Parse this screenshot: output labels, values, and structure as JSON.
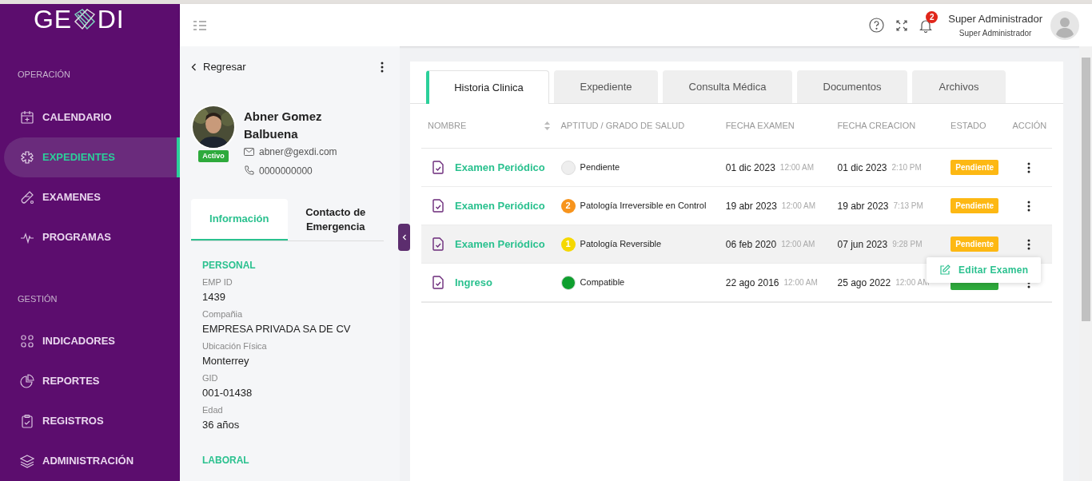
{
  "logo": {
    "left": "GE",
    "right": "DI"
  },
  "sidebar": {
    "sections": [
      {
        "title": "OPERACIÓN",
        "items": [
          {
            "label": "CALENDARIO",
            "selected": false
          },
          {
            "label": "EXPEDIENTES",
            "selected": true
          },
          {
            "label": "EXAMENES",
            "selected": false
          },
          {
            "label": "PROGRAMAS",
            "selected": false
          }
        ]
      },
      {
        "title": "GESTIÓN",
        "items": [
          {
            "label": "INDICADORES",
            "selected": false
          },
          {
            "label": "REPORTES",
            "selected": false
          },
          {
            "label": "REGISTROS",
            "selected": false
          },
          {
            "label": "ADMINISTRACIÓN",
            "selected": false
          }
        ]
      }
    ]
  },
  "topbar": {
    "notifications": "2",
    "user_name": "Super Administrador",
    "user_role": "Super Administrador"
  },
  "profile": {
    "back": "Regresar",
    "name_line1": "Abner Gomez",
    "name_line2": "Balbuena",
    "status": "Activo",
    "email": "abner@gexdi.com",
    "phone": "0000000000",
    "tabs": [
      {
        "label": "Información",
        "selected": true
      },
      {
        "label": "Contacto de Emergencia",
        "selected": false
      }
    ],
    "sections": [
      {
        "title": "PERSONAL",
        "fields": [
          {
            "label": "EMP ID",
            "value": "1439"
          },
          {
            "label": "Compañia",
            "value": "EMPRESA PRIVADA SA DE CV"
          },
          {
            "label": "Ubicación Física",
            "value": "Monterrey"
          },
          {
            "label": "GID",
            "value": "001-01438"
          },
          {
            "label": "Edad",
            "value": "36 años"
          }
        ]
      },
      {
        "title": "LABORAL"
      }
    ]
  },
  "tabs": [
    {
      "label": "Historia Clinica",
      "selected": true
    },
    {
      "label": "Expediente",
      "selected": false
    },
    {
      "label": "Consulta Médica",
      "selected": false
    },
    {
      "label": "Documentos",
      "selected": false
    },
    {
      "label": "Archivos",
      "selected": false
    }
  ],
  "table": {
    "columns": [
      "NOMBRE",
      "APTITUD / GRADO DE SALUD",
      "FECHA EXAMEN",
      "FECHA CREACION",
      "ESTADO",
      "ACCIÓN"
    ],
    "rows": [
      {
        "name": "Examen Periódico",
        "grade": "",
        "color": "#eeeeee",
        "aptitud": "Pendiente",
        "exam_date": "01 dic 2023",
        "exam_time": "12:00 AM",
        "created_date": "01 dic 2023",
        "created_time": "2:10 PM",
        "status": {
          "kind": "pending",
          "text": "Pendiente"
        },
        "highlighted": false
      },
      {
        "name": "Examen Periódico",
        "grade": "2",
        "color": "#f7941d",
        "aptitud": "Patología Irreversible en Control",
        "exam_date": "19 abr 2023",
        "exam_time": "12:00 AM",
        "created_date": "19 abr 2023",
        "created_time": "7:13 PM",
        "status": {
          "kind": "pending",
          "text": "Pendiente"
        },
        "highlighted": false
      },
      {
        "name": "Examen Periódico",
        "grade": "1",
        "color": "#f5d800",
        "aptitud": "Patología Reversible",
        "exam_date": "06 feb 2020",
        "exam_time": "12:00 AM",
        "created_date": "07 jun 2023",
        "created_time": "9:28 PM",
        "status": {
          "kind": "pending",
          "text": "Pendiente"
        },
        "highlighted": true
      },
      {
        "name": "Ingreso",
        "grade": "",
        "color": "#0e9f2e",
        "aptitud": "Compatible",
        "exam_date": "22 ago 2016",
        "exam_time": "12:00 AM",
        "created_date": "25 ago 2022",
        "created_time": "12:00 AM",
        "status": {
          "kind": "done"
        },
        "highlighted": false
      }
    ]
  },
  "action_menu": {
    "items": [
      "Editar Examen"
    ]
  }
}
